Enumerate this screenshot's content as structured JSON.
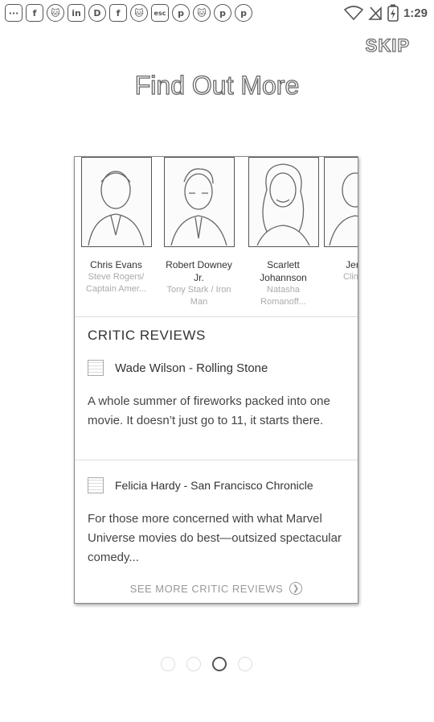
{
  "status_bar": {
    "notif_icons": [
      {
        "name": "more-icon",
        "glyph": "···"
      },
      {
        "name": "facebook-icon",
        "glyph": "f"
      },
      {
        "name": "cat-app-icon",
        "glyph": "🐱"
      },
      {
        "name": "linkedin-icon",
        "glyph": "in"
      },
      {
        "name": "messenger-icon",
        "glyph": "D"
      },
      {
        "name": "facebook-icon",
        "glyph": "f"
      },
      {
        "name": "cat-app-icon",
        "glyph": "🐱"
      },
      {
        "name": "esc-icon",
        "glyph": "esc"
      },
      {
        "name": "pinterest-icon",
        "glyph": "p"
      },
      {
        "name": "cat-app-icon",
        "glyph": "🐱"
      },
      {
        "name": "pinterest-icon",
        "glyph": "p"
      },
      {
        "name": "pinterest-icon",
        "glyph": "p"
      }
    ],
    "time": "1:29"
  },
  "header": {
    "skip_label": "SKIP",
    "title": "Find Out More"
  },
  "cast": [
    {
      "name": "Chris Evans",
      "role": "Steve Rogers/ Captain Amer..."
    },
    {
      "name": "Robert Downey Jr.",
      "role": "Tony Stark / Iron Man"
    },
    {
      "name": "Scarlett Johannson",
      "role": "Natasha Romanoff..."
    },
    {
      "name": "Jermy",
      "role": "Clint Ha"
    }
  ],
  "critic_reviews": {
    "title": "CRITIC REVIEWS",
    "reviews": [
      {
        "author": "Wade Wilson - Rolling Stone",
        "text": "A whole summer of fireworks packed into one movie. It doesn’t just go to 11, it starts there."
      },
      {
        "author": "Felicia Hardy - San Francisco Chronicle",
        "text": "For those more concerned with what Marvel Universe movies do best—outsized spectacular comedy..."
      }
    ],
    "see_more_label": "SEE MORE CRITIC REVIEWS"
  },
  "pagination": {
    "total": 4,
    "active_index": 2
  }
}
